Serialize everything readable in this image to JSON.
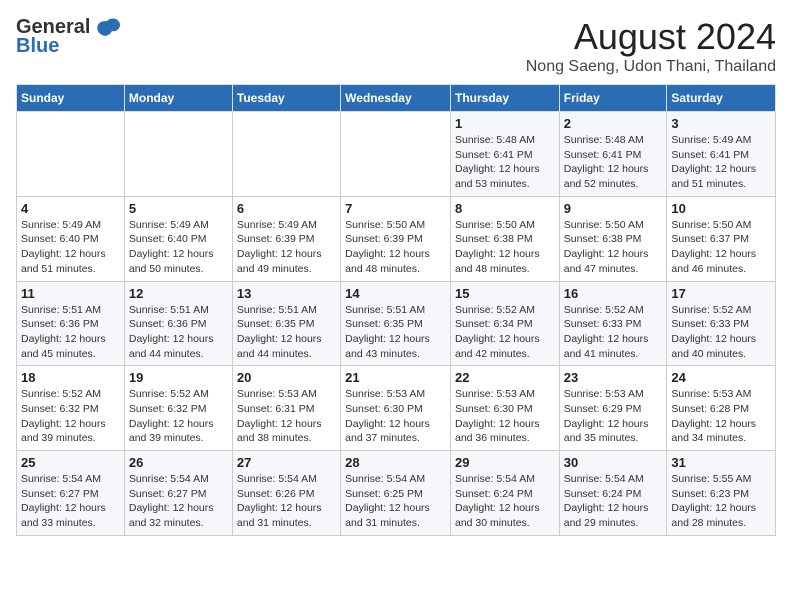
{
  "logo": {
    "general": "General",
    "blue": "Blue"
  },
  "title": "August 2024",
  "location": "Nong Saeng, Udon Thani, Thailand",
  "days_of_week": [
    "Sunday",
    "Monday",
    "Tuesday",
    "Wednesday",
    "Thursday",
    "Friday",
    "Saturday"
  ],
  "weeks": [
    [
      {
        "day": "",
        "detail": ""
      },
      {
        "day": "",
        "detail": ""
      },
      {
        "day": "",
        "detail": ""
      },
      {
        "day": "",
        "detail": ""
      },
      {
        "day": "1",
        "detail": "Sunrise: 5:48 AM\nSunset: 6:41 PM\nDaylight: 12 hours\nand 53 minutes."
      },
      {
        "day": "2",
        "detail": "Sunrise: 5:48 AM\nSunset: 6:41 PM\nDaylight: 12 hours\nand 52 minutes."
      },
      {
        "day": "3",
        "detail": "Sunrise: 5:49 AM\nSunset: 6:41 PM\nDaylight: 12 hours\nand 51 minutes."
      }
    ],
    [
      {
        "day": "4",
        "detail": "Sunrise: 5:49 AM\nSunset: 6:40 PM\nDaylight: 12 hours\nand 51 minutes."
      },
      {
        "day": "5",
        "detail": "Sunrise: 5:49 AM\nSunset: 6:40 PM\nDaylight: 12 hours\nand 50 minutes."
      },
      {
        "day": "6",
        "detail": "Sunrise: 5:49 AM\nSunset: 6:39 PM\nDaylight: 12 hours\nand 49 minutes."
      },
      {
        "day": "7",
        "detail": "Sunrise: 5:50 AM\nSunset: 6:39 PM\nDaylight: 12 hours\nand 48 minutes."
      },
      {
        "day": "8",
        "detail": "Sunrise: 5:50 AM\nSunset: 6:38 PM\nDaylight: 12 hours\nand 48 minutes."
      },
      {
        "day": "9",
        "detail": "Sunrise: 5:50 AM\nSunset: 6:38 PM\nDaylight: 12 hours\nand 47 minutes."
      },
      {
        "day": "10",
        "detail": "Sunrise: 5:50 AM\nSunset: 6:37 PM\nDaylight: 12 hours\nand 46 minutes."
      }
    ],
    [
      {
        "day": "11",
        "detail": "Sunrise: 5:51 AM\nSunset: 6:36 PM\nDaylight: 12 hours\nand 45 minutes."
      },
      {
        "day": "12",
        "detail": "Sunrise: 5:51 AM\nSunset: 6:36 PM\nDaylight: 12 hours\nand 44 minutes."
      },
      {
        "day": "13",
        "detail": "Sunrise: 5:51 AM\nSunset: 6:35 PM\nDaylight: 12 hours\nand 44 minutes."
      },
      {
        "day": "14",
        "detail": "Sunrise: 5:51 AM\nSunset: 6:35 PM\nDaylight: 12 hours\nand 43 minutes."
      },
      {
        "day": "15",
        "detail": "Sunrise: 5:52 AM\nSunset: 6:34 PM\nDaylight: 12 hours\nand 42 minutes."
      },
      {
        "day": "16",
        "detail": "Sunrise: 5:52 AM\nSunset: 6:33 PM\nDaylight: 12 hours\nand 41 minutes."
      },
      {
        "day": "17",
        "detail": "Sunrise: 5:52 AM\nSunset: 6:33 PM\nDaylight: 12 hours\nand 40 minutes."
      }
    ],
    [
      {
        "day": "18",
        "detail": "Sunrise: 5:52 AM\nSunset: 6:32 PM\nDaylight: 12 hours\nand 39 minutes."
      },
      {
        "day": "19",
        "detail": "Sunrise: 5:52 AM\nSunset: 6:32 PM\nDaylight: 12 hours\nand 39 minutes."
      },
      {
        "day": "20",
        "detail": "Sunrise: 5:53 AM\nSunset: 6:31 PM\nDaylight: 12 hours\nand 38 minutes."
      },
      {
        "day": "21",
        "detail": "Sunrise: 5:53 AM\nSunset: 6:30 PM\nDaylight: 12 hours\nand 37 minutes."
      },
      {
        "day": "22",
        "detail": "Sunrise: 5:53 AM\nSunset: 6:30 PM\nDaylight: 12 hours\nand 36 minutes."
      },
      {
        "day": "23",
        "detail": "Sunrise: 5:53 AM\nSunset: 6:29 PM\nDaylight: 12 hours\nand 35 minutes."
      },
      {
        "day": "24",
        "detail": "Sunrise: 5:53 AM\nSunset: 6:28 PM\nDaylight: 12 hours\nand 34 minutes."
      }
    ],
    [
      {
        "day": "25",
        "detail": "Sunrise: 5:54 AM\nSunset: 6:27 PM\nDaylight: 12 hours\nand 33 minutes."
      },
      {
        "day": "26",
        "detail": "Sunrise: 5:54 AM\nSunset: 6:27 PM\nDaylight: 12 hours\nand 32 minutes."
      },
      {
        "day": "27",
        "detail": "Sunrise: 5:54 AM\nSunset: 6:26 PM\nDaylight: 12 hours\nand 31 minutes."
      },
      {
        "day": "28",
        "detail": "Sunrise: 5:54 AM\nSunset: 6:25 PM\nDaylight: 12 hours\nand 31 minutes."
      },
      {
        "day": "29",
        "detail": "Sunrise: 5:54 AM\nSunset: 6:24 PM\nDaylight: 12 hours\nand 30 minutes."
      },
      {
        "day": "30",
        "detail": "Sunrise: 5:54 AM\nSunset: 6:24 PM\nDaylight: 12 hours\nand 29 minutes."
      },
      {
        "day": "31",
        "detail": "Sunrise: 5:55 AM\nSunset: 6:23 PM\nDaylight: 12 hours\nand 28 minutes."
      }
    ]
  ]
}
